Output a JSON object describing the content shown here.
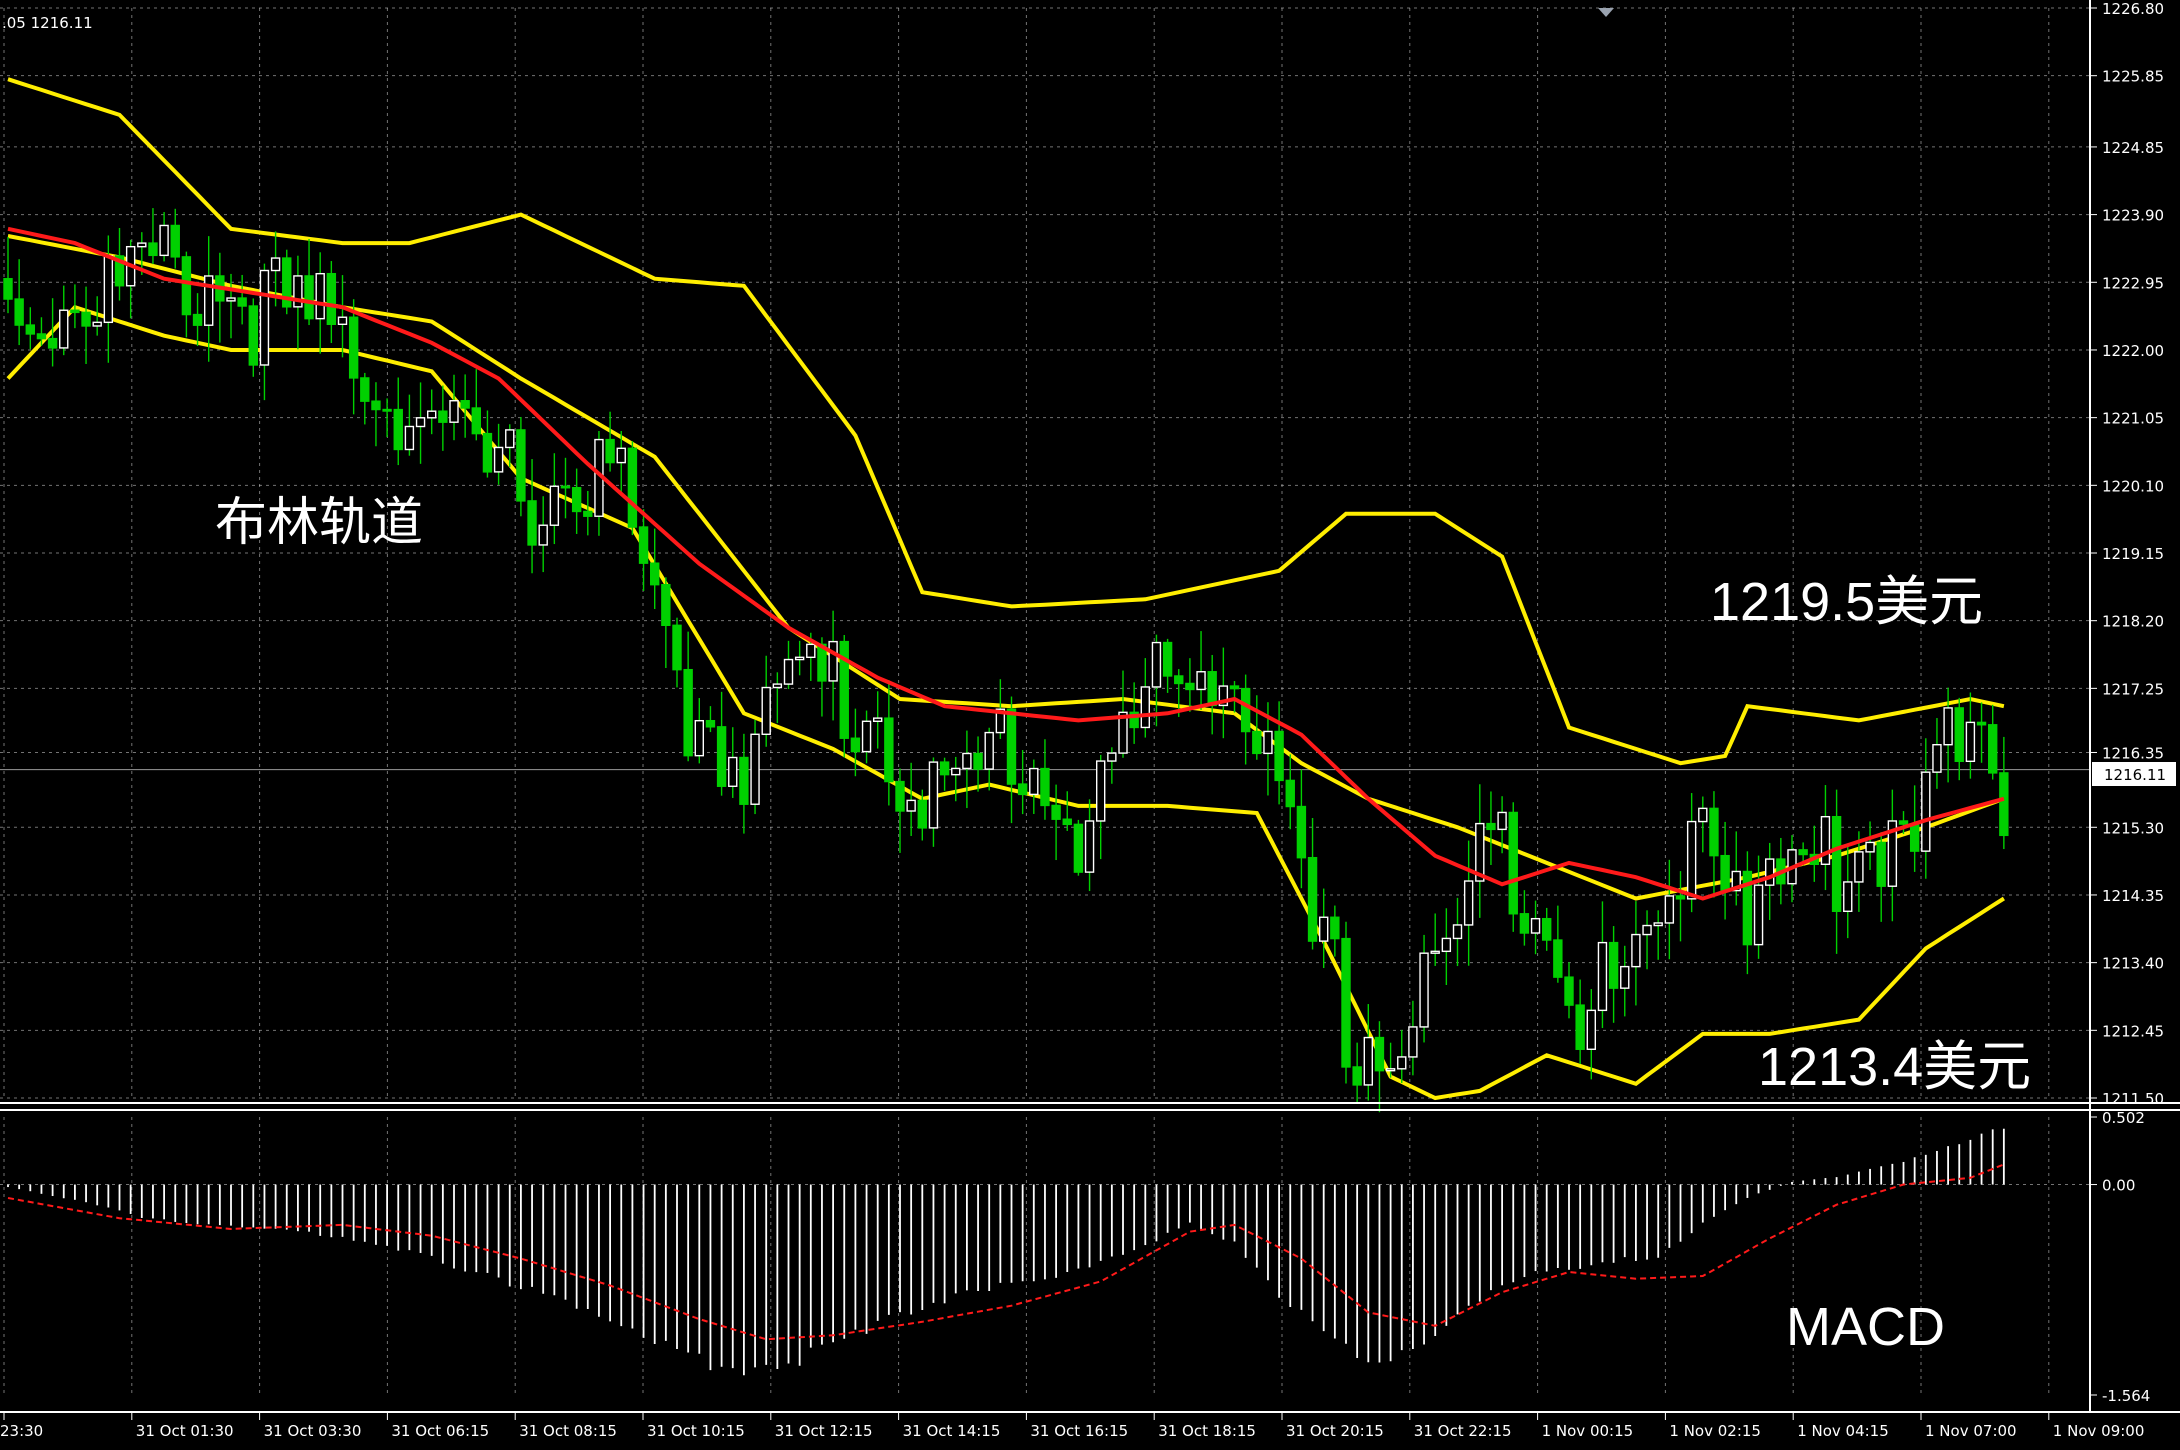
{
  "header_text": ".05 1216.11",
  "current_price_label": "1216.11",
  "colors": {
    "background": "#000000",
    "grid": "#C0C0C0",
    "axis": "#FFFFFF",
    "bull_candle": "#FFFFFF",
    "bear_candle": "#00D000",
    "bollinger": "#FFEE00",
    "moving_average": "#FF1A1A",
    "macd_histogram": "#FFFFFF",
    "macd_signal": "#FF1A1A",
    "text": "#FFFFFF"
  },
  "annotations": {
    "bollinger_label": "布林轨道",
    "upper_value": "1219.5美元",
    "lower_value": "1213.4美元",
    "macd_label": "MACD"
  },
  "chart_data": [
    {
      "type": "candlestick",
      "title": "",
      "indicators": [
        "Bollinger Bands",
        "Moving Average"
      ],
      "ylim": [
        1211.5,
        1226.8
      ],
      "y_ticks": [
        1226.8,
        1225.85,
        1224.85,
        1223.9,
        1222.95,
        1222.0,
        1221.05,
        1220.1,
        1219.15,
        1218.2,
        1217.25,
        1216.35,
        1215.3,
        1214.35,
        1213.4,
        1212.45,
        1211.5
      ],
      "y_tick_labels": [
        "1226.80",
        "1225.85",
        "1224.85",
        "1223.90",
        "1222.95",
        "1222.00",
        "1221.05",
        "1220.10",
        "1219.15",
        "1218.20",
        "1217.25",
        "1216.35",
        "1215.30",
        "1214.35",
        "1213.40",
        "1212.45",
        "1211.50"
      ],
      "x_tick_labels": [
        "23:30",
        "31 Oct 01:30",
        "31 Oct 03:30",
        "31 Oct 06:15",
        "31 Oct 08:15",
        "31 Oct 10:15",
        "31 Oct 12:15",
        "31 Oct 14:15",
        "31 Oct 16:15",
        "31 Oct 18:15",
        "31 Oct 20:15",
        "31 Oct 22:15",
        "1 Nov 00:15",
        "1 Nov 02:15",
        "1 Nov 04:15",
        "1 Nov 07:00",
        "1 Nov 09:00"
      ],
      "close_keypoints": [
        [
          0,
          1223.0
        ],
        [
          6,
          1223.2
        ],
        [
          12,
          1223.4
        ],
        [
          18,
          1223.5
        ],
        [
          24,
          1222.9
        ],
        [
          30,
          1222.6
        ],
        [
          36,
          1221.7
        ],
        [
          42,
          1220.7
        ],
        [
          48,
          1220.5
        ],
        [
          54,
          1220.8
        ],
        [
          60,
          1217.5
        ],
        [
          66,
          1216.9
        ],
        [
          72,
          1217.9
        ],
        [
          78,
          1217.3
        ],
        [
          84,
          1215.8
        ],
        [
          90,
          1217.1
        ],
        [
          96,
          1215.7
        ],
        [
          102,
          1217.4
        ],
        [
          108,
          1218.3
        ],
        [
          112,
          1217.2
        ],
        [
          116,
          1214.5
        ],
        [
          120,
          1213.0
        ],
        [
          124,
          1212.6
        ],
        [
          130,
          1214.3
        ],
        [
          134,
          1215.7
        ],
        [
          138,
          1214.6
        ],
        [
          142,
          1213.1
        ],
        [
          148,
          1214.1
        ],
        [
          152,
          1216.5
        ],
        [
          156,
          1214.7
        ],
        [
          162,
          1215.1
        ],
        [
          168,
          1215.7
        ],
        [
          174,
          1216.7
        ],
        [
          179,
          1216.11
        ]
      ],
      "current_price": 1216.11,
      "bollinger": {
        "upper": [
          [
            0,
            1225.8
          ],
          [
            10,
            1225.3
          ],
          [
            20,
            1223.7
          ],
          [
            30,
            1223.5
          ],
          [
            36,
            1223.5
          ],
          [
            46,
            1223.9
          ],
          [
            58,
            1223.0
          ],
          [
            66,
            1222.9
          ],
          [
            76,
            1220.8
          ],
          [
            82,
            1218.6
          ],
          [
            90,
            1218.4
          ],
          [
            102,
            1218.5
          ],
          [
            114,
            1218.9
          ],
          [
            120,
            1219.7
          ],
          [
            128,
            1219.7
          ],
          [
            134,
            1219.1
          ],
          [
            140,
            1216.7
          ],
          [
            150,
            1216.2
          ],
          [
            154,
            1216.3
          ],
          [
            156,
            1217.0
          ],
          [
            166,
            1216.8
          ],
          [
            176,
            1217.1
          ],
          [
            179,
            1217.0
          ]
        ],
        "middle": [
          [
            0,
            1223.6
          ],
          [
            10,
            1223.3
          ],
          [
            20,
            1222.9
          ],
          [
            30,
            1222.6
          ],
          [
            38,
            1222.4
          ],
          [
            46,
            1221.6
          ],
          [
            58,
            1220.5
          ],
          [
            70,
            1218.1
          ],
          [
            80,
            1217.1
          ],
          [
            90,
            1217.0
          ],
          [
            100,
            1217.1
          ],
          [
            110,
            1216.9
          ],
          [
            116,
            1216.2
          ],
          [
            122,
            1215.7
          ],
          [
            130,
            1215.3
          ],
          [
            138,
            1214.8
          ],
          [
            146,
            1214.3
          ],
          [
            156,
            1214.6
          ],
          [
            164,
            1214.9
          ],
          [
            172,
            1215.3
          ],
          [
            179,
            1215.7
          ]
        ],
        "lower": [
          [
            0,
            1221.6
          ],
          [
            6,
            1222.6
          ],
          [
            14,
            1222.2
          ],
          [
            20,
            1222.0
          ],
          [
            30,
            1222.0
          ],
          [
            38,
            1221.7
          ],
          [
            46,
            1220.2
          ],
          [
            56,
            1219.5
          ],
          [
            66,
            1216.9
          ],
          [
            74,
            1216.4
          ],
          [
            82,
            1215.7
          ],
          [
            88,
            1215.9
          ],
          [
            96,
            1215.6
          ],
          [
            104,
            1215.6
          ],
          [
            112,
            1215.5
          ],
          [
            118,
            1213.7
          ],
          [
            124,
            1211.8
          ],
          [
            128,
            1211.5
          ],
          [
            132,
            1211.6
          ],
          [
            138,
            1212.1
          ],
          [
            146,
            1211.7
          ],
          [
            152,
            1212.4
          ],
          [
            158,
            1212.4
          ],
          [
            166,
            1212.6
          ],
          [
            172,
            1213.6
          ],
          [
            179,
            1214.3
          ]
        ]
      },
      "moving_average": [
        [
          0,
          1223.7
        ],
        [
          6,
          1223.5
        ],
        [
          14,
          1223.0
        ],
        [
          22,
          1222.8
        ],
        [
          30,
          1222.6
        ],
        [
          38,
          1222.1
        ],
        [
          44,
          1221.6
        ],
        [
          52,
          1220.4
        ],
        [
          62,
          1219.0
        ],
        [
          70,
          1218.1
        ],
        [
          78,
          1217.4
        ],
        [
          84,
          1217.0
        ],
        [
          90,
          1216.9
        ],
        [
          96,
          1216.8
        ],
        [
          104,
          1216.9
        ],
        [
          110,
          1217.1
        ],
        [
          116,
          1216.6
        ],
        [
          122,
          1215.7
        ],
        [
          128,
          1214.9
        ],
        [
          134,
          1214.5
        ],
        [
          140,
          1214.8
        ],
        [
          146,
          1214.6
        ],
        [
          152,
          1214.3
        ],
        [
          158,
          1214.6
        ],
        [
          164,
          1215.0
        ],
        [
          172,
          1215.4
        ],
        [
          179,
          1215.7
        ]
      ],
      "price_annotations": [
        1219.5,
        1213.4
      ]
    },
    {
      "type": "bar",
      "title": "MACD",
      "ylim": [
        -1.564,
        0.502
      ],
      "y_tick_labels": [
        "0.502",
        "0.00",
        "-1.564"
      ],
      "histogram_keypoints": [
        [
          0,
          -0.02
        ],
        [
          6,
          -0.12
        ],
        [
          12,
          -0.25
        ],
        [
          18,
          -0.32
        ],
        [
          24,
          -0.35
        ],
        [
          30,
          -0.4
        ],
        [
          36,
          -0.52
        ],
        [
          42,
          -0.68
        ],
        [
          48,
          -0.85
        ],
        [
          54,
          -1.05
        ],
        [
          60,
          -1.3
        ],
        [
          66,
          -1.5
        ],
        [
          70,
          -1.4
        ],
        [
          76,
          -1.15
        ],
        [
          82,
          -0.95
        ],
        [
          88,
          -0.8
        ],
        [
          94,
          -0.7
        ],
        [
          100,
          -0.55
        ],
        [
          106,
          -0.3
        ],
        [
          110,
          -0.45
        ],
        [
          114,
          -0.85
        ],
        [
          118,
          -1.15
        ],
        [
          122,
          -1.4
        ],
        [
          126,
          -1.3
        ],
        [
          130,
          -1.0
        ],
        [
          136,
          -0.7
        ],
        [
          142,
          -0.62
        ],
        [
          148,
          -0.55
        ],
        [
          152,
          -0.3
        ],
        [
          156,
          -0.1
        ],
        [
          160,
          0.02
        ],
        [
          164,
          0.06
        ],
        [
          170,
          0.18
        ],
        [
          176,
          0.35
        ],
        [
          179,
          0.45
        ]
      ],
      "signal_keypoints": [
        [
          0,
          -0.1
        ],
        [
          10,
          -0.25
        ],
        [
          20,
          -0.33
        ],
        [
          30,
          -0.3
        ],
        [
          38,
          -0.38
        ],
        [
          46,
          -0.55
        ],
        [
          54,
          -0.75
        ],
        [
          62,
          -1.0
        ],
        [
          68,
          -1.15
        ],
        [
          74,
          -1.12
        ],
        [
          82,
          -1.02
        ],
        [
          90,
          -0.9
        ],
        [
          98,
          -0.72
        ],
        [
          106,
          -0.35
        ],
        [
          110,
          -0.3
        ],
        [
          116,
          -0.55
        ],
        [
          122,
          -0.95
        ],
        [
          128,
          -1.05
        ],
        [
          134,
          -0.8
        ],
        [
          140,
          -0.65
        ],
        [
          146,
          -0.7
        ],
        [
          152,
          -0.68
        ],
        [
          158,
          -0.4
        ],
        [
          164,
          -0.15
        ],
        [
          170,
          0.0
        ],
        [
          176,
          0.05
        ],
        [
          179,
          0.15
        ]
      ]
    }
  ]
}
